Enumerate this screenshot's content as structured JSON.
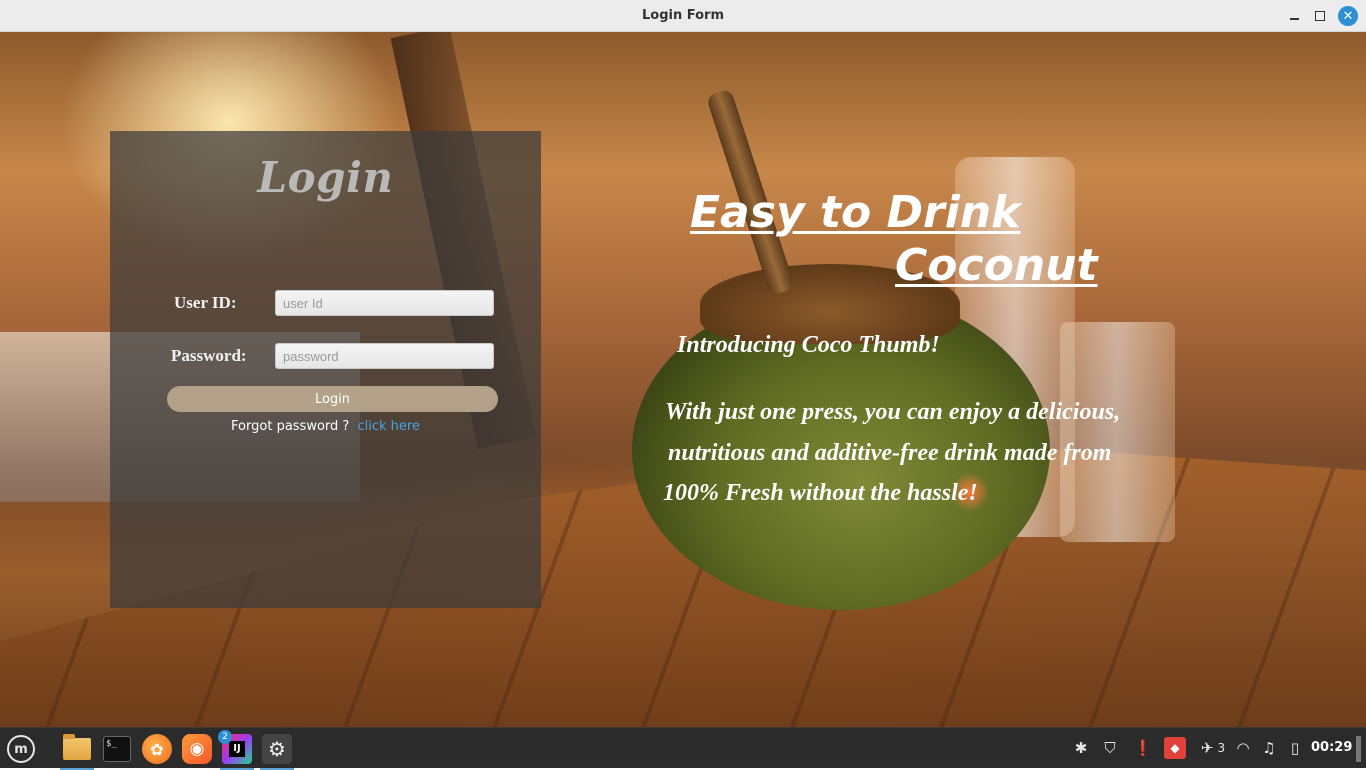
{
  "window": {
    "title": "Login Form"
  },
  "login": {
    "title": "Login",
    "user_id_label": "User ID:",
    "user_id_placeholder": "user Id",
    "password_label": "Password:",
    "password_placeholder": "password",
    "button_label": "Login",
    "forgot_text": "Forgot password ?",
    "forgot_link": "click here"
  },
  "promo": {
    "headline_line1": "Easy to Drink",
    "headline_line2": "Coconut",
    "intro": "Introducing Coco Thumb!",
    "description_lines": [
      "With just one press, you can enjoy a delicious,",
      "nutritious and additive-free drink made from",
      "100% Fresh without the hassle!"
    ]
  },
  "colors": {
    "panel_bg": "#3c3c3c",
    "button_bg": "#b3a088",
    "link": "#45a3e6",
    "close_button": "#2e8fd6"
  },
  "taskbar": {
    "apps": [
      {
        "name": "file-manager-icon"
      },
      {
        "name": "terminal-icon",
        "glyph": "$_"
      },
      {
        "name": "orange-app-icon"
      },
      {
        "name": "firefox-icon"
      },
      {
        "name": "intellij-icon",
        "badge": "2"
      },
      {
        "name": "settings-icon"
      }
    ],
    "tray": {
      "notification_count": "3",
      "clock": "00:29"
    }
  }
}
